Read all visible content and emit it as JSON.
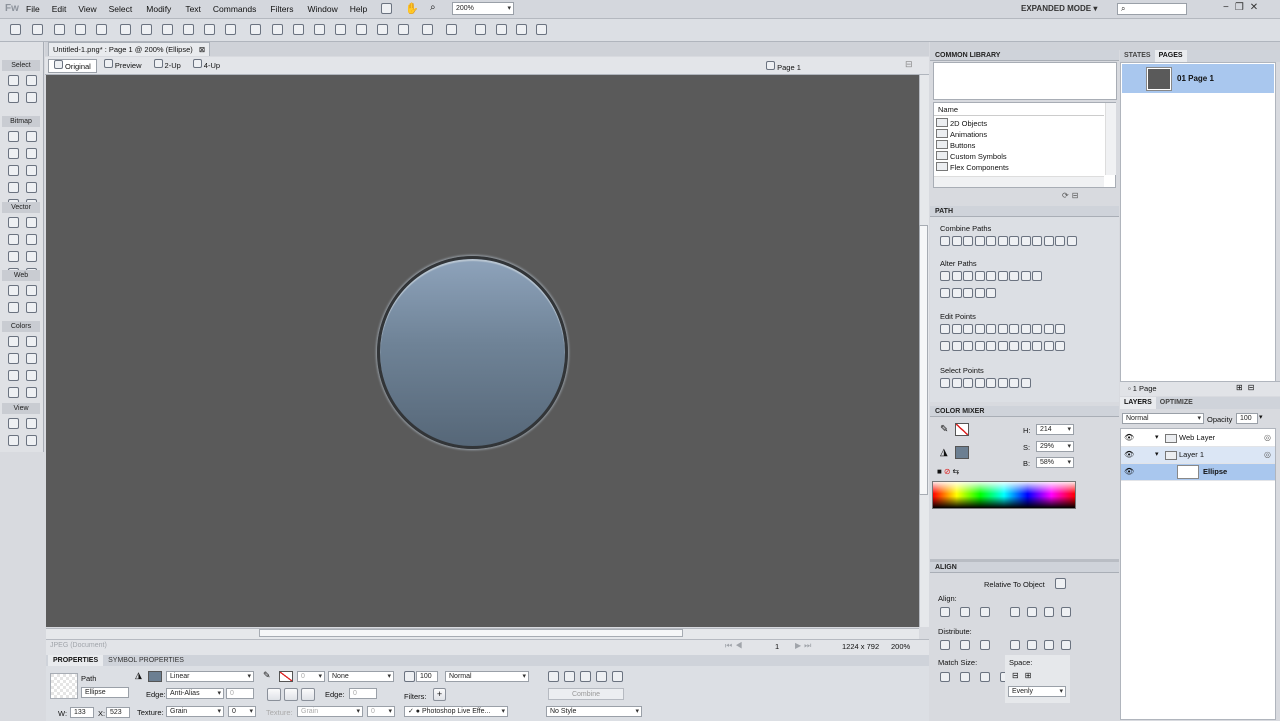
{
  "app": {
    "logo": "Fw",
    "mode": "EXPANDED MODE",
    "zoom": "200%"
  },
  "menu": [
    "File",
    "Edit",
    "View",
    "Select",
    "Modify",
    "Text",
    "Commands",
    "Filters",
    "Window",
    "Help"
  ],
  "document": {
    "tab_title": "Untitled-1.png* : Page 1 @ 200% (Ellipse)",
    "views": [
      "Original",
      "Preview",
      "2-Up",
      "4-Up"
    ],
    "page_label": "Page 1",
    "status_left": "JPEG (Document)",
    "page_number": "1",
    "canvas_size": "1224 x 792",
    "zoom": "200%"
  },
  "tools": {
    "sections": [
      "Select",
      "Bitmap",
      "Vector",
      "Web",
      "Colors",
      "View"
    ]
  },
  "common_library": {
    "title": "COMMON LIBRARY",
    "column": "Name",
    "items": [
      "2D Objects",
      "Animations",
      "Buttons",
      "Custom Symbols",
      "Flex Components"
    ]
  },
  "path_panel": {
    "title": "PATH",
    "groups": [
      "Combine Paths",
      "Alter Paths",
      "Edit Points",
      "Select Points"
    ]
  },
  "color_mixer": {
    "title": "COLOR MIXER",
    "h_label": "H:",
    "h": "214",
    "s_label": "S:",
    "s": "29%",
    "b_label": "B:",
    "b": "58%"
  },
  "align": {
    "title": "ALIGN",
    "relative": "Relative To Object",
    "align_label": "Align:",
    "distribute_label": "Distribute:",
    "match_size_label": "Match Size:",
    "space_label": "Space:",
    "space_value": "Evenly"
  },
  "pages": {
    "tabs": [
      "STATES",
      "PAGES"
    ],
    "page_name": "01 Page 1",
    "count": "1 Page"
  },
  "layers": {
    "tabs": [
      "LAYERS",
      "OPTIMIZE"
    ],
    "blend": "Normal",
    "opacity_label": "Opacity",
    "opacity": "100",
    "items": [
      "Web Layer",
      "Layer 1",
      "Ellipse"
    ]
  },
  "properties": {
    "tabs": [
      "PROPERTIES",
      "SYMBOL PROPERTIES"
    ],
    "object_type": "Path",
    "object_name": "Ellipse",
    "fill_type": "Linear",
    "edge_label": "Edge:",
    "edge": "Anti-Alias",
    "edge_value": "0",
    "texture_label": "Texture:",
    "texture": "Grain",
    "texture_value": "0",
    "stroke_size": "0",
    "stroke_type": "None",
    "stroke_edge_label": "Edge:",
    "stroke_edge_value": "0",
    "stroke_texture_label": "Texture:",
    "stroke_texture": "Grain",
    "stroke_texture_value": "0",
    "opacity": "100",
    "blend": "Normal",
    "filters_label": "Filters:",
    "filter": "Photoshop Live Effe...",
    "combine": "Combine",
    "style": "No Style",
    "w_label": "W:",
    "w": "133",
    "x_label": "X:",
    "x": "523"
  },
  "colors": {
    "canvas": "#5a5a5a",
    "ellipse_top": "#8da2b9",
    "ellipse_bottom": "#546576",
    "panel": "#d8dadf",
    "selected_row": "#a9c7ee"
  }
}
